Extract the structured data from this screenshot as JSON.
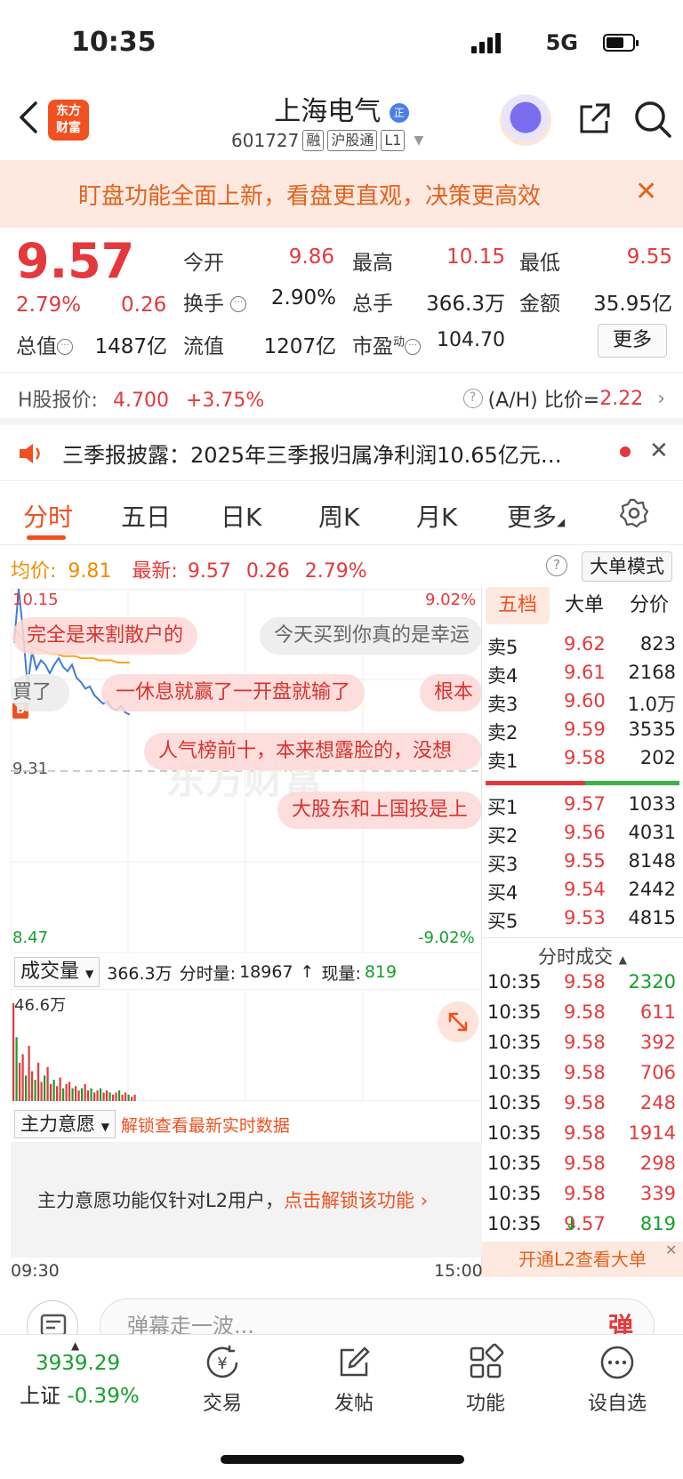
{
  "status_bar": {
    "time": "10:35",
    "network": "5G"
  },
  "header": {
    "logo_line1": "东方",
    "logo_line2": "财富",
    "stock_name": "上海电气",
    "stock_code": "601727",
    "tags": [
      "融",
      "沪股通",
      "L1"
    ]
  },
  "banner": {
    "text": "盯盘功能全面上新，看盘更直观，决策更高效"
  },
  "quote": {
    "price": "9.57",
    "change_pct": "2.79%",
    "change_amt": "0.26",
    "fields": [
      {
        "label": "今开",
        "value": "9.86",
        "color": "red"
      },
      {
        "label": "最高",
        "value": "10.15",
        "color": "red"
      },
      {
        "label": "最低",
        "value": "9.55",
        "color": "red"
      },
      {
        "label": "换手",
        "value": "2.90%",
        "color": "dark"
      },
      {
        "label": "总手",
        "value": "366.3万",
        "color": "dark"
      },
      {
        "label": "金额",
        "value": "35.95亿",
        "color": "dark"
      },
      {
        "label": "总值",
        "value": "1487亿",
        "color": "dark"
      },
      {
        "label": "流值",
        "value": "1207亿",
        "color": "dark"
      },
      {
        "label": "市盈",
        "value": "104.70",
        "color": "dark"
      }
    ],
    "pe_sup": "动",
    "more_label": "更多"
  },
  "h_share": {
    "label": "H股报价:",
    "price": "4.700",
    "change": "+3.75%",
    "ah_label": "(A/H) 比价=",
    "ah_value": "2.22"
  },
  "news": {
    "text": "三季报披露：2025年三季报归属净利润10.65亿元…"
  },
  "tabs": [
    "分时",
    "五日",
    "日K",
    "周K",
    "月K",
    "更多"
  ],
  "chart_info": {
    "avg_label": "均价:",
    "avg_value": "9.81",
    "latest_label": "最新:",
    "latest_value": "9.57",
    "latest_chg": "0.26",
    "latest_pct": "2.79%",
    "mode_label": "大单模式"
  },
  "chart": {
    "y_high": "10.15",
    "y_pre": "9.31",
    "y_low": "8.47",
    "pct_high": "9.02%",
    "pct_low": "-9.02%",
    "time_start": "09:30",
    "time_end": "15:00",
    "buy_marker": "B"
  },
  "chart_data": {
    "type": "line",
    "ylim": [
      8.47,
      10.15
    ],
    "price_series": [
      9.9,
      10.15,
      9.95,
      9.7,
      9.86,
      9.78,
      9.82,
      9.8,
      9.76,
      9.8,
      9.83,
      9.79,
      9.77,
      9.8,
      9.74,
      9.72,
      9.69,
      9.7,
      9.66,
      9.64,
      9.62,
      9.63,
      9.6,
      9.59,
      9.61,
      9.58,
      9.57
    ],
    "avg_series": [
      9.97,
      9.93,
      9.9,
      9.88,
      9.87,
      9.86,
      9.85,
      9.85,
      9.84,
      9.84,
      9.84,
      9.83,
      9.83,
      9.83,
      9.82,
      9.82,
      9.82,
      9.81,
      9.81,
      9.81
    ],
    "volume_max": "46.6万",
    "volumes": [
      46,
      30,
      18,
      22,
      12,
      26,
      14,
      10,
      18,
      9,
      12,
      16,
      8,
      10,
      7,
      11,
      6,
      8,
      9,
      6,
      7,
      5,
      6,
      8,
      5,
      6,
      4,
      5,
      6,
      4,
      5,
      4,
      3,
      4,
      5,
      3,
      4,
      3,
      2,
      3
    ]
  },
  "danmu": [
    "完全是来割散户的",
    "今天买到你真的是幸运",
    "一休息就赢了一开盘就输了",
    "根本",
    "買了",
    "人气榜前十，本来想露脸的，没想",
    "大股东和上国投是上"
  ],
  "order_book": {
    "tabs": [
      "五档",
      "大单",
      "分价"
    ],
    "asks": [
      {
        "label": "卖5",
        "price": "9.62",
        "vol": "823"
      },
      {
        "label": "卖4",
        "price": "9.61",
        "vol": "2168"
      },
      {
        "label": "卖3",
        "price": "9.60",
        "vol": "1.0万"
      },
      {
        "label": "卖2",
        "price": "9.59",
        "vol": "3535"
      },
      {
        "label": "卖1",
        "price": "9.58",
        "vol": "202"
      }
    ],
    "bids": [
      {
        "label": "买1",
        "price": "9.57",
        "vol": "1033"
      },
      {
        "label": "买2",
        "price": "9.56",
        "vol": "4031"
      },
      {
        "label": "买3",
        "price": "9.55",
        "vol": "8148"
      },
      {
        "label": "买4",
        "price": "9.54",
        "vol": "2442"
      },
      {
        "label": "买5",
        "price": "9.53",
        "vol": "4815"
      }
    ],
    "trades_title": "分时成交",
    "trades": [
      {
        "time": "10:35",
        "price": "9.58",
        "vol": "2320"
      },
      {
        "time": "10:35",
        "price": "9.58",
        "vol": "611"
      },
      {
        "time": "10:35",
        "price": "9.58",
        "vol": "392"
      },
      {
        "time": "10:35",
        "price": "9.58",
        "vol": "706"
      },
      {
        "time": "10:35",
        "price": "9.58",
        "vol": "248"
      },
      {
        "time": "10:35",
        "price": "9.58",
        "vol": "1914"
      },
      {
        "time": "10:35",
        "price": "9.58",
        "vol": "298"
      },
      {
        "time": "10:35",
        "price": "9.58",
        "vol": "339"
      },
      {
        "time": "10:35",
        "price": "9.57",
        "vol": "819",
        "arrow": "↓"
      }
    ],
    "l2_label": "开通L2查看大单"
  },
  "volume_row": {
    "select": "成交量",
    "total": "366.3万",
    "period_label": "分时量:",
    "period_value": "18967",
    "arrow": "↑",
    "now_label": "现量:",
    "now_value": "819"
  },
  "main_force": {
    "select": "主力意愿",
    "unlock": "解锁查看最新实时数据",
    "notice": "主力意愿功能仅针对L2用户，",
    "notice_link": "点击解锁该功能"
  },
  "comment_bar": {
    "placeholder": "弹幕走一波...",
    "danmu_btn": "弹"
  },
  "bottom_bar": {
    "index_value": "3939.29",
    "index_name": "上证",
    "index_change": "-0.39%",
    "items": [
      "交易",
      "发帖",
      "功能",
      "设自选"
    ]
  }
}
